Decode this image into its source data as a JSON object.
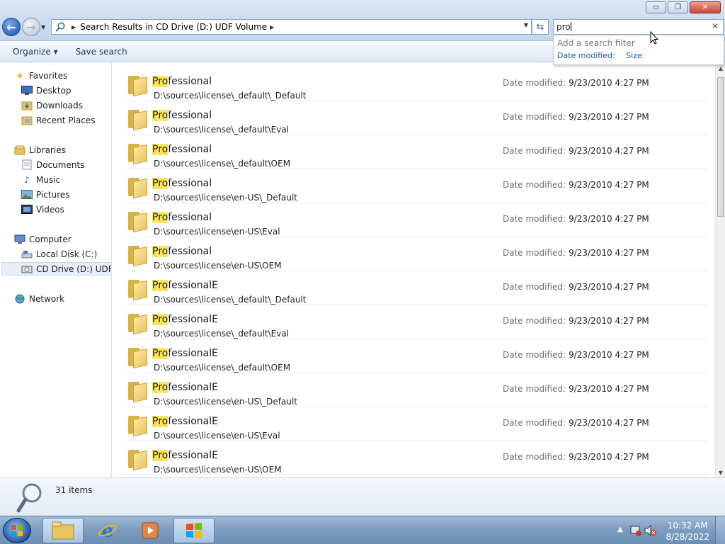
{
  "window": {
    "minimize_glyph": "▭",
    "restore_glyph": "❐",
    "close_glyph": "✕"
  },
  "address_bar": {
    "breadcrumb": "Search Results in CD Drive (D:) UDF Volume"
  },
  "search": {
    "value": "pro",
    "suggestion_hint": "Add a search filter",
    "filters": [
      "Date modified:",
      "Size:"
    ]
  },
  "toolbar": {
    "organize_label": "Organize ▾",
    "save_search_label": "Save search"
  },
  "sidebar": {
    "favorites": {
      "label": "Favorites",
      "items": [
        "Desktop",
        "Downloads",
        "Recent Places"
      ]
    },
    "libraries": {
      "label": "Libraries",
      "items": [
        "Documents",
        "Music",
        "Pictures",
        "Videos"
      ]
    },
    "computer": {
      "label": "Computer",
      "items": [
        "Local Disk (C:)",
        "CD Drive (D:) UDF Volume"
      ]
    },
    "network": {
      "label": "Network"
    }
  },
  "results": [
    {
      "match": "Pro",
      "rest": "fessional",
      "path": "D:\\sources\\license\\_default\\_Default",
      "date_label": "Date modified:",
      "date": "9/23/2010 4:27 PM"
    },
    {
      "match": "Pro",
      "rest": "fessional",
      "path": "D:\\sources\\license\\_default\\Eval",
      "date_label": "Date modified:",
      "date": "9/23/2010 4:27 PM"
    },
    {
      "match": "Pro",
      "rest": "fessional",
      "path": "D:\\sources\\license\\_default\\OEM",
      "date_label": "Date modified:",
      "date": "9/23/2010 4:27 PM"
    },
    {
      "match": "Pro",
      "rest": "fessional",
      "path": "D:\\sources\\license\\en-US\\_Default",
      "date_label": "Date modified:",
      "date": "9/23/2010 4:27 PM"
    },
    {
      "match": "Pro",
      "rest": "fessional",
      "path": "D:\\sources\\license\\en-US\\Eval",
      "date_label": "Date modified:",
      "date": "9/23/2010 4:27 PM"
    },
    {
      "match": "Pro",
      "rest": "fessional",
      "path": "D:\\sources\\license\\en-US\\OEM",
      "date_label": "Date modified:",
      "date": "9/23/2010 4:27 PM"
    },
    {
      "match": "Pro",
      "rest": "fessionalE",
      "path": "D:\\sources\\license\\_default\\_Default",
      "date_label": "Date modified:",
      "date": "9/23/2010 4:27 PM"
    },
    {
      "match": "Pro",
      "rest": "fessionalE",
      "path": "D:\\sources\\license\\_default\\Eval",
      "date_label": "Date modified:",
      "date": "9/23/2010 4:27 PM"
    },
    {
      "match": "Pro",
      "rest": "fessionalE",
      "path": "D:\\sources\\license\\_default\\OEM",
      "date_label": "Date modified:",
      "date": "9/23/2010 4:27 PM"
    },
    {
      "match": "Pro",
      "rest": "fessionalE",
      "path": "D:\\sources\\license\\en-US\\_Default",
      "date_label": "Date modified:",
      "date": "9/23/2010 4:27 PM"
    },
    {
      "match": "Pro",
      "rest": "fessionalE",
      "path": "D:\\sources\\license\\en-US\\Eval",
      "date_label": "Date modified:",
      "date": "9/23/2010 4:27 PM"
    },
    {
      "match": "Pro",
      "rest": "fessionalE",
      "path": "D:\\sources\\license\\en-US\\OEM",
      "date_label": "Date modified:",
      "date": "9/23/2010 4:27 PM"
    }
  ],
  "details": {
    "item_count": "31 items"
  },
  "taskbar": {
    "time": "10:32 AM",
    "date": "8/28/2022"
  },
  "colors": {
    "highlight": "#fce55a",
    "link_blue": "#1c5aa6",
    "folder_yellow": "#e8c563"
  }
}
